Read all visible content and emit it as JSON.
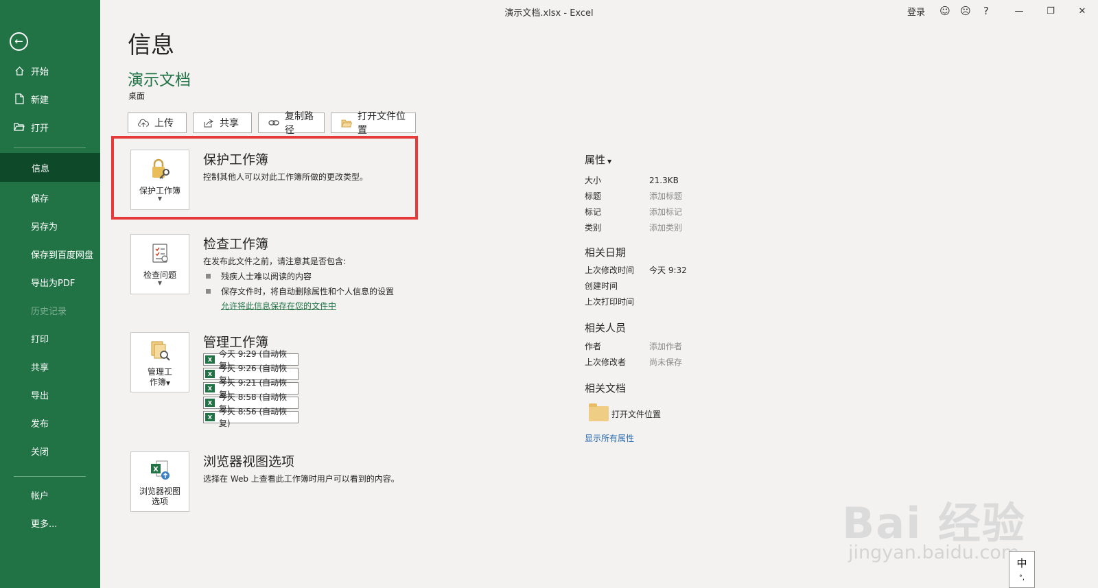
{
  "window": {
    "title": "演示文档.xlsx  -  Excel",
    "signin": "登录",
    "help": "?"
  },
  "sidebar": {
    "items": [
      {
        "label": "开始"
      },
      {
        "label": "新建"
      },
      {
        "label": "打开"
      },
      {
        "label": "信息"
      },
      {
        "label": "保存"
      },
      {
        "label": "另存为"
      },
      {
        "label": "保存到百度网盘"
      },
      {
        "label": "导出为PDF"
      },
      {
        "label": "历史记录"
      },
      {
        "label": "打印"
      },
      {
        "label": "共享"
      },
      {
        "label": "导出"
      },
      {
        "label": "发布"
      },
      {
        "label": "关闭"
      },
      {
        "label": "帐户"
      },
      {
        "label": "更多..."
      }
    ]
  },
  "main": {
    "page_title": "信息",
    "doc_title": "演示文档",
    "doc_location": "桌面",
    "actions": {
      "upload": "上传",
      "share": "共享",
      "copy_path": "复制路径",
      "open_location": "打开文件位置"
    },
    "protect": {
      "tile": "保护工作簿",
      "heading": "保护工作簿",
      "desc": "控制其他人可以对此工作簿所做的更改类型。"
    },
    "inspect": {
      "tile": "检查问题",
      "heading": "检查工作簿",
      "desc": "在发布此文件之前，请注意其是否包含:",
      "bullets": [
        "残疾人士难以阅读的内容",
        "保存文件时，将自动删除属性和个人信息的设置"
      ],
      "link": "允许将此信息保存在您的文件中"
    },
    "manage": {
      "tile_line1": "管理工",
      "tile_line2": "作簿",
      "heading": "管理工作簿",
      "versions": [
        "今天 9:29 (自动恢复)",
        "今天 9:26 (自动恢复)",
        "今天 9:21 (自动恢复)",
        "今天 8:58 (自动恢复)",
        "今天 8:56 (自动恢复)"
      ]
    },
    "browser": {
      "tile_line1": "浏览器视图",
      "tile_line2": "选项",
      "heading": "浏览器视图选项",
      "desc": "选择在 Web 上查看此工作簿时用户可以看到的内容。"
    }
  },
  "properties": {
    "heading": "属性",
    "size_key": "大小",
    "size_val": "21.3KB",
    "title_key": "标题",
    "title_val": "添加标题",
    "tags_key": "标记",
    "tags_val": "添加标记",
    "category_key": "类别",
    "category_val": "添加类别",
    "dates_heading": "相关日期",
    "modified_key": "上次修改时间",
    "modified_val": "今天 9:32",
    "created_key": "创建时间",
    "printed_key": "上次打印时间",
    "people_heading": "相关人员",
    "author_key": "作者",
    "author_val": "添加作者",
    "modby_key": "上次修改者",
    "modby_val": "尚未保存",
    "docs_heading": "相关文档",
    "open_location": "打开文件位置",
    "show_all": "显示所有属性"
  },
  "overlay": {
    "watermark": "Bai 经验",
    "watermark_url": "jingyan.baidu.com",
    "ime": "中",
    "ime_sub": "°,"
  },
  "colors": {
    "sidebar": "#217346",
    "active": "#0e4a2a",
    "highlight": "#e63a3a",
    "link": "#2b6cb0"
  }
}
